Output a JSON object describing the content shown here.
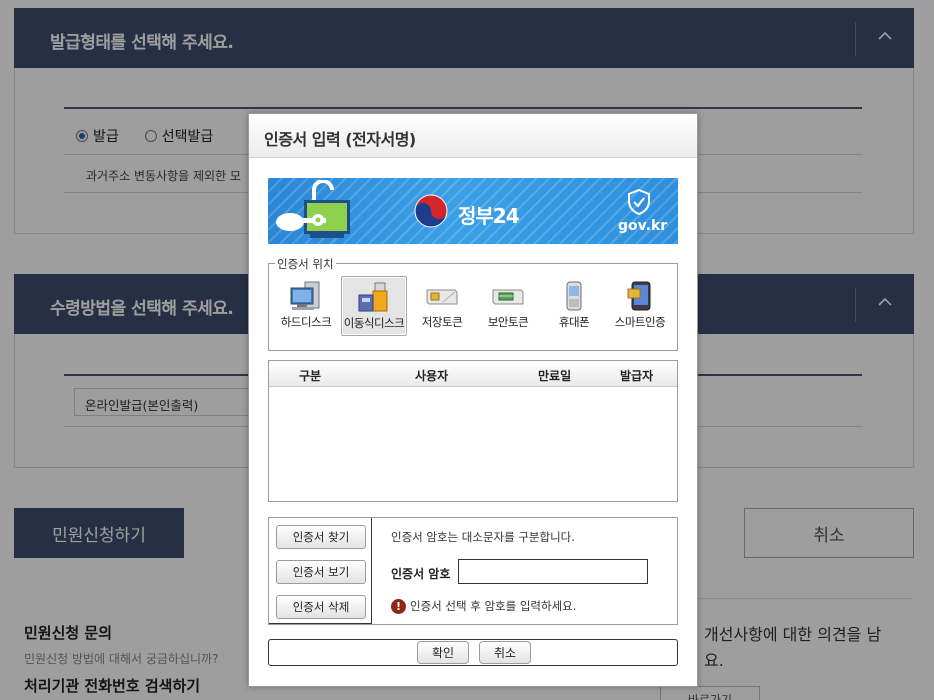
{
  "background": {
    "section1": {
      "title": "발급형태를 선택해 주세요."
    },
    "radio_options": [
      {
        "label": "발급",
        "selected": true
      },
      {
        "label": "선택발급",
        "selected": false
      }
    ],
    "address_note": "과거주소 변동사항을 제외한 모",
    "section2": {
      "title": "수령방법을 선택해 주세요."
    },
    "receive_method": "온라인발급(본인출력)",
    "apply_button": "민원신청하기",
    "cancel_button": "취소",
    "inquiry_title": "민원신청 문의",
    "inquiry_sub": "민원신청 방법에 대해서 궁금하십니까?",
    "agency_title": "처리기관 전화번호 검색하기",
    "feedback_text": "개선사항에 대한 의견을 남",
    "feedback_text2": "요.",
    "bottom_button": "바로가기"
  },
  "dialog": {
    "title": "인증서 입력 (전자서명)",
    "banner": {
      "brand": "정부24",
      "domain": "gov.kr"
    },
    "location_legend": "인증서 위치",
    "storage": [
      {
        "label": "하드디스크",
        "icon": "hard-disk-icon",
        "active": false
      },
      {
        "label": "이동식디스크",
        "icon": "usb-drive-icon",
        "active": true
      },
      {
        "label": "저장토큰",
        "icon": "storage-token-icon",
        "active": false
      },
      {
        "label": "보안토큰",
        "icon": "security-token-icon",
        "active": false
      },
      {
        "label": "휴대폰",
        "icon": "mobile-phone-icon",
        "active": false
      },
      {
        "label": "스마트인증",
        "icon": "smart-cert-icon",
        "active": false
      }
    ],
    "table_headers": [
      "구분",
      "사용자",
      "만료일",
      "발급자"
    ],
    "buttons": {
      "find": "인증서 찾기",
      "view": "인증서 보기",
      "delete": "인증서 삭제"
    },
    "password_note": "인증서 암호는 대소문자를 구분합니다.",
    "password_label": "인증서 암호",
    "password_value": "",
    "hint": "인증서 선택 후 암호를 입력하세요.",
    "confirm": "확인",
    "cancel": "취소"
  },
  "colors": {
    "header_navy": "#3e4d6e",
    "banner_blue": "#2a86d6",
    "warning": "#8a2a14"
  }
}
